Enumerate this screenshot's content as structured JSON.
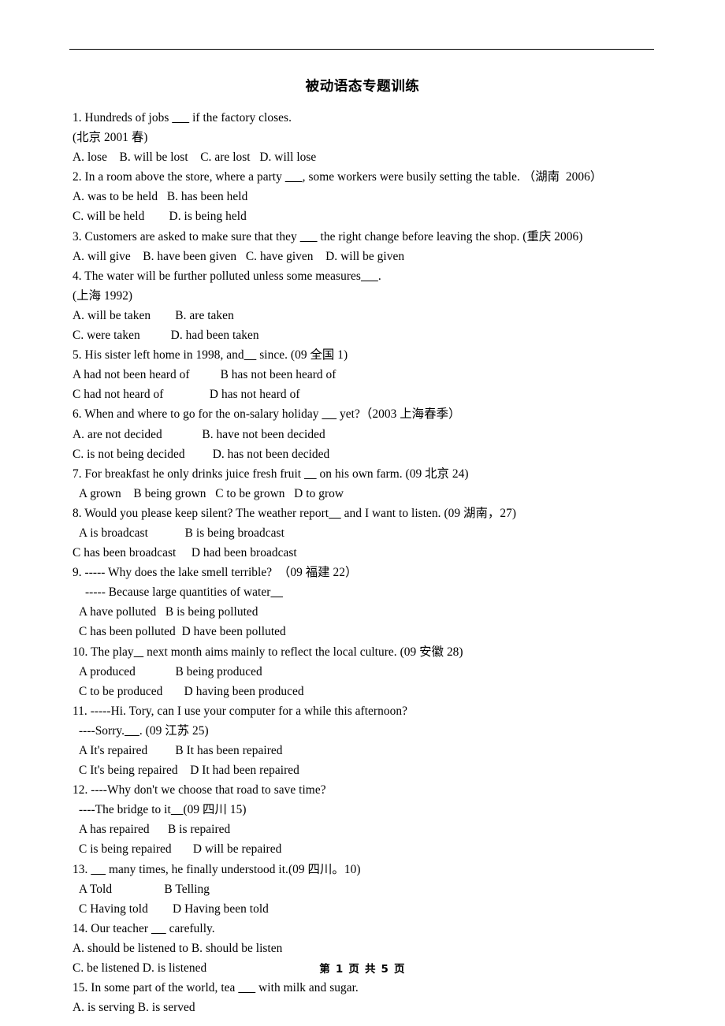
{
  "document": {
    "title": "被动语态专题训练",
    "footer": "第 1 页 共 5 页",
    "lines": [
      {
        "indent": 0,
        "text": "1. Hundreds of jobs _______ if the factory closes."
      },
      {
        "indent": 0,
        "text": "(北京 2001 春)"
      },
      {
        "indent": 0,
        "text": "A. lose    B. will be lost    C. are lost   D. will lose"
      },
      {
        "indent": 0,
        "text": "2. In a room above the store, where a party _______, some workers were busily setting the table. （湖南  2006）"
      },
      {
        "indent": 0,
        "text": "A. was to be held   B. has been held"
      },
      {
        "indent": 0,
        "text": "C. will be held        D. is being held"
      },
      {
        "indent": 0,
        "text": "3. Customers are asked to make sure that they _______ the right change before leaving the shop. (重庆 2006)"
      },
      {
        "indent": 0,
        "text": "A. will give    B. have been given   C. have given    D. will be given"
      },
      {
        "indent": 0,
        "text": "4. The water will be further polluted unless some measures_______."
      },
      {
        "indent": 0,
        "text": "(上海 1992)"
      },
      {
        "indent": 0,
        "text": "A. will be taken        B. are taken"
      },
      {
        "indent": 0,
        "text": "C. were taken          D. had been taken"
      },
      {
        "indent": 0,
        "text": "5. His sister left home in 1998, and_____ since. (09 全国 1)"
      },
      {
        "indent": 0,
        "text": "A had not been heard of          B has not been heard of"
      },
      {
        "indent": 0,
        "text": "C had not heard of               D has not heard of"
      },
      {
        "indent": 0,
        "text": "6. When and where to go for the on-salary holiday ______ yet?（2003 上海春季）"
      },
      {
        "indent": 0,
        "text": "A. are not decided             B. have not been decided"
      },
      {
        "indent": 0,
        "text": "C. is not being decided         D. has not been decided"
      },
      {
        "indent": 0,
        "text": "7. For breakfast he only drinks juice fresh fruit _____ on his own farm. (09 北京 24)"
      },
      {
        "indent": 1,
        "text": "A grown    B being grown   C to be grown   D to grow"
      },
      {
        "indent": 0,
        "text": "8. Would you please keep silent? The weather report_____ and I want to listen. (09 湖南，27)"
      },
      {
        "indent": 1,
        "text": "A is broadcast            B is being broadcast"
      },
      {
        "indent": 0,
        "text": "C has been broadcast     D had been broadcast"
      },
      {
        "indent": 0,
        "text": "9. ----- Why does the lake smell terrible?  （09 福建 22）"
      },
      {
        "indent": 2,
        "text": "----- Because large quantities of water_____"
      },
      {
        "indent": 1,
        "text": "A have polluted   B is being polluted"
      },
      {
        "indent": 1,
        "text": "C has been polluted  D have been polluted"
      },
      {
        "indent": 0,
        "text": "10. The play____ next month aims mainly to reflect the local culture. (09 安徽 28)"
      },
      {
        "indent": 1,
        "text": "A produced             B being produced"
      },
      {
        "indent": 1,
        "text": "C to be produced       D having been produced"
      },
      {
        "indent": 0,
        "text": "11. -----Hi. Tory, can I use your computer for a while this afternoon?"
      },
      {
        "indent": 1,
        "text": "----Sorry.______. (09 江苏 25)"
      },
      {
        "indent": 1,
        "text": "A It's repaired         B It has been repaired"
      },
      {
        "indent": 1,
        "text": "C It's being repaired    D It had been repaired"
      },
      {
        "indent": 0,
        "text": "12. ----Why don't we choose that road to save time?"
      },
      {
        "indent": 1,
        "text": "----The bridge to it_____(09 四川 15)"
      },
      {
        "indent": 1,
        "text": "A has repaired      B is repaired"
      },
      {
        "indent": 1,
        "text": "C is being repaired       D will be repaired"
      },
      {
        "indent": 0,
        "text": "13. ______ many times, he finally understood it.(09 四川。10)"
      },
      {
        "indent": 1,
        "text": "A Told                 B Telling"
      },
      {
        "indent": 1,
        "text": "C Having told        D Having been told"
      },
      {
        "indent": 0,
        "text": "14. Our teacher ______ carefully."
      },
      {
        "indent": 0,
        "text": "A. should be listened to B. should be listen"
      },
      {
        "indent": 0,
        "text": "C. be listened D. is listened"
      },
      {
        "indent": 0,
        "text": "15. In some part of the world, tea _______ with milk and sugar."
      },
      {
        "indent": 0,
        "text": "A. is serving B. is served"
      }
    ]
  }
}
